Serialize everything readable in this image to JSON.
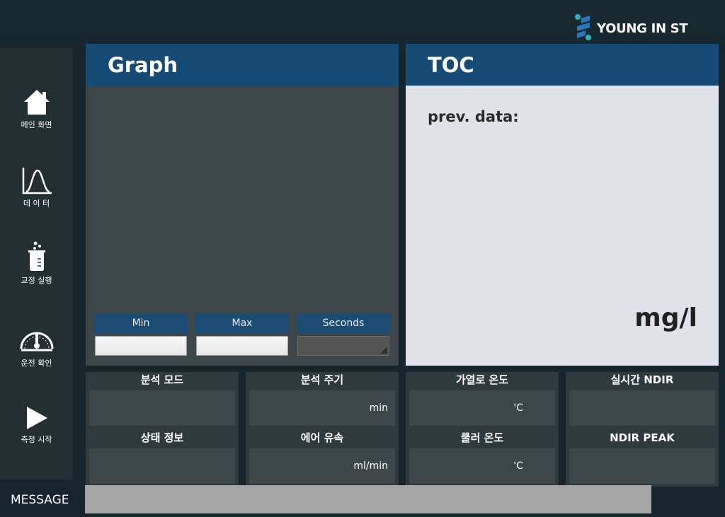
{
  "brand": {
    "name": "YOUNG IN ST"
  },
  "sidebar": {
    "items": [
      {
        "label": "메인 화면",
        "icon": "home-icon"
      },
      {
        "label": "데 이 터",
        "icon": "chart-curve-icon"
      },
      {
        "label": "교정 실행",
        "icon": "beaker-icon"
      },
      {
        "label": "운전 확인",
        "icon": "gauge-icon"
      },
      {
        "label": "측정 시작",
        "icon": "play-icon"
      }
    ]
  },
  "graph": {
    "title": "Graph",
    "controls": {
      "min_label": "Min",
      "max_label": "Max",
      "seconds_label": "Seconds",
      "min_value": "",
      "max_value": "",
      "seconds_value": ""
    }
  },
  "toc": {
    "title": "TOC",
    "prev_label": "prev. data:",
    "value": "",
    "unit": "mg/l"
  },
  "status": {
    "cells": [
      {
        "title": "분석 모드",
        "value": "",
        "unit": ""
      },
      {
        "title": "분석 주기",
        "value": "",
        "unit": "min"
      },
      {
        "title": "가열로 온도",
        "value": "",
        "unit": "'C"
      },
      {
        "title": "실시간 NDIR",
        "value": "",
        "unit": ""
      },
      {
        "title": "상태 정보",
        "value": "",
        "unit": ""
      },
      {
        "title": "에어 유속",
        "value": "",
        "unit": "ml/min"
      },
      {
        "title": "쿨러 온도",
        "value": "",
        "unit": "'C"
      },
      {
        "title": "NDIR PEAK",
        "value": "",
        "unit": ""
      }
    ]
  },
  "message": {
    "label": "MESSAGE",
    "text": ""
  },
  "colors": {
    "header": "#154b74",
    "accent_teal": "#2fb3b7",
    "accent_blue": "#2a76bd"
  }
}
